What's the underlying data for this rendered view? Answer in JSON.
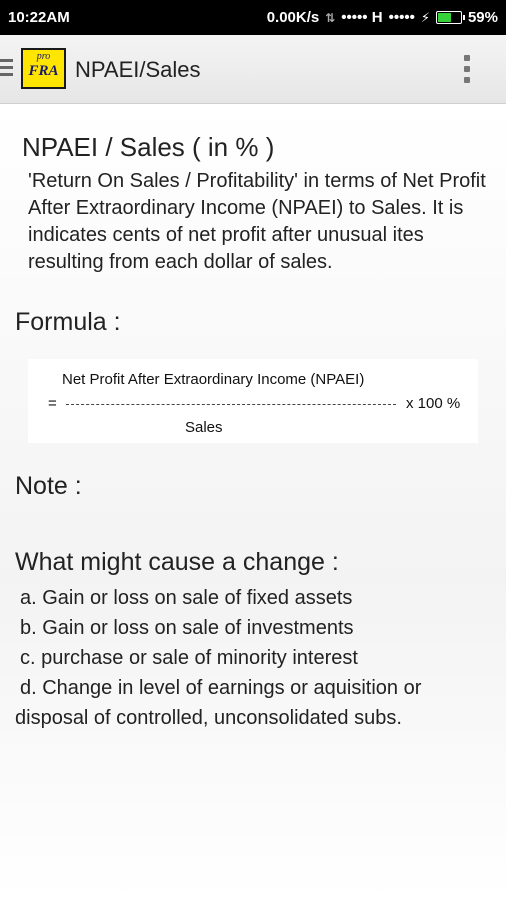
{
  "statusbar": {
    "time": "10:22AM",
    "speed": "0.00K/s",
    "signal1": "••••• H",
    "signal2": "•••••",
    "battery": "59%",
    "battery_level": 0.59
  },
  "appbar": {
    "logo_pro": "pro",
    "logo_fra": "FRA",
    "title": "NPAEI/Sales"
  },
  "content": {
    "heading": "NPAEI / Sales ( in % )",
    "description": "'Return On Sales / Profitability' in terms of Net Profit After Extraordinary Income (NPAEI) to Sales. It is indicates cents of net profit after unusual ites resulting from each dollar of sales.",
    "formula_label": "Formula :",
    "formula": {
      "numerator": "Net Profit After Extraordinary Income (NPAEI)",
      "equals": "=",
      "multiplier": "x  100 %",
      "denominator": "Sales"
    },
    "note_label": "Note :",
    "change_label": "What might cause a change :",
    "changes": [
      "a. Gain or loss on sale of fixed assets",
      "b. Gain or loss on sale of investments",
      "c. purchase or sale of minority interest",
      "d. Change in level of earnings or aquisition or disposal of controlled, unconsolidated subs."
    ]
  }
}
